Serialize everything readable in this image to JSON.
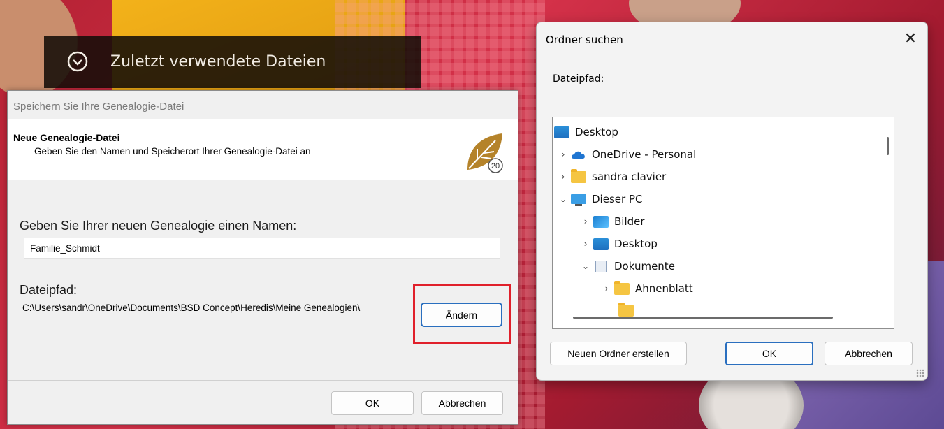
{
  "background": {
    "recent_files_title": "Zuletzt verwendete Dateien"
  },
  "save_dialog": {
    "title": "Speichern Sie Ihre Genealogie-Datei",
    "header_title": "Neue Genealogie-Datei",
    "header_subtitle": "Geben Sie den Namen und Speicherort Ihrer Genealogie-Datei an",
    "logo_badge": "20",
    "name_label": "Geben Sie Ihrer neuen Genealogie einen Namen:",
    "name_value": "Familie_Schmidt",
    "path_label": "Dateipfad:",
    "path_value": "C:\\Users\\sandr\\OneDrive\\Documents\\BSD Concept\\Heredis\\Meine Genealogien\\",
    "change_button": "Ändern",
    "ok_button": "OK",
    "cancel_button": "Abbrechen",
    "highlight_color": "#e0202b"
  },
  "folder_dialog": {
    "title": "Ordner suchen",
    "close_glyph": "✕",
    "path_label": "Dateipfad:",
    "tree": [
      {
        "label": "Desktop",
        "icon": "desktop-icon",
        "toggle": ""
      },
      {
        "label": "OneDrive - Personal",
        "icon": "onedrive-icon",
        "toggle": "›"
      },
      {
        "label": "sandra clavier",
        "icon": "folder-icon",
        "toggle": "›"
      },
      {
        "label": "Dieser PC",
        "icon": "pc-icon",
        "toggle": "⌄"
      },
      {
        "label": "Bilder",
        "icon": "pictures-icon",
        "toggle": "›"
      },
      {
        "label": "Desktop",
        "icon": "desktop-icon",
        "toggle": "›"
      },
      {
        "label": "Dokumente",
        "icon": "documents-icon",
        "toggle": "⌄"
      },
      {
        "label": "Ahnenblatt",
        "icon": "folder-icon",
        "toggle": "›"
      }
    ],
    "new_folder_button": "Neuen Ordner erstellen",
    "ok_button": "OK",
    "cancel_button": "Abbrechen",
    "accent_color": "#2a6fbf"
  }
}
